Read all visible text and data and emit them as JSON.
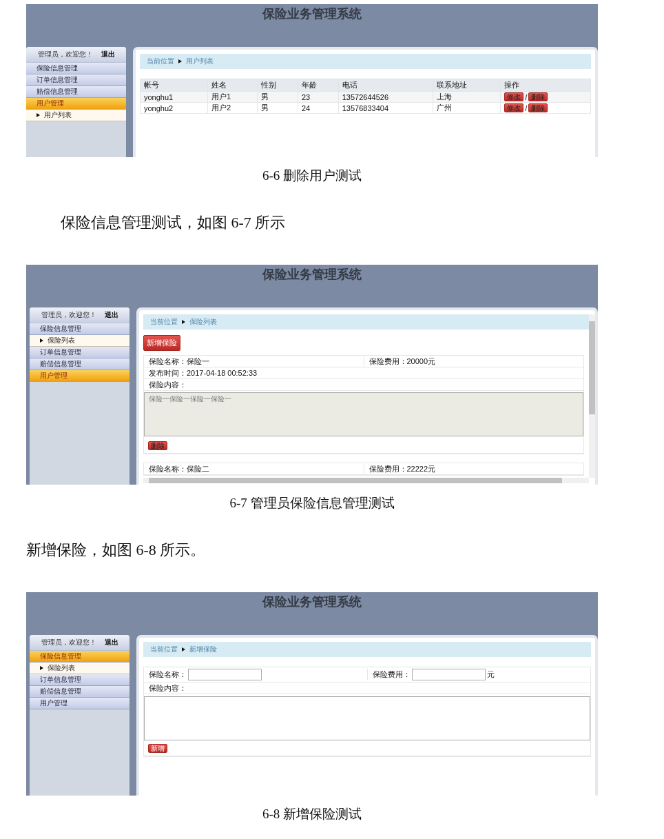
{
  "blocks": [
    {
      "kind": "figure",
      "screen": {
        "kind": "user-table",
        "title": "保险业务管理系统",
        "greeting": "管理员，欢迎您！",
        "logout": "退出",
        "nav": [
          {
            "label": "保险信息管理",
            "selected": false
          },
          {
            "label": "订单信息管理",
            "selected": false
          },
          {
            "label": "赔偿信息管理",
            "selected": false
          },
          {
            "label": "用户管理",
            "selected": true,
            "children": [
              {
                "label": "用户列表"
              }
            ]
          }
        ],
        "breadcrumb": {
          "home": "当前位置",
          "current": "用户列表"
        },
        "columns": [
          "帐号",
          "姓名",
          "性别",
          "年龄",
          "电话",
          "联系地址",
          "操作"
        ],
        "rows": [
          {
            "cells": [
              "yonghu1",
              "用户1",
              "男",
              "23",
              "13572644526",
              "上海"
            ],
            "edit": "修改",
            "separator": "/",
            "delete": "删除"
          },
          {
            "cells": [
              "yonghu2",
              "用户2",
              "男",
              "24",
              "13576833404",
              "广州"
            ],
            "edit": "修改",
            "separator": "/",
            "delete": "删除"
          }
        ]
      }
    },
    {
      "kind": "caption",
      "text": "6-6 删除用户测试"
    },
    {
      "kind": "paragraph",
      "indent": true,
      "text": "保险信息管理测试，如图 6-7 所示"
    },
    {
      "kind": "figure",
      "screen": {
        "kind": "insurance-list",
        "title": "保险业务管理系统",
        "greeting": "管理员，欢迎您！",
        "logout": "退出",
        "nav": [
          {
            "label": "保险信息管理",
            "selected": false,
            "children": [
              {
                "label": "保险列表"
              }
            ]
          },
          {
            "label": "订单信息管理",
            "selected": false
          },
          {
            "label": "赔偿信息管理",
            "selected": false
          },
          {
            "label": "用户管理",
            "selected": true
          }
        ],
        "breadcrumb": {
          "home": "当前位置",
          "current": "保险列表"
        },
        "add_button": "新增保险",
        "records": [
          {
            "name": "保险名称：保险一",
            "fee": "保险费用：20000元",
            "time": "发布时间：2017-04-18 00:52:33",
            "content_label": "保险内容：",
            "content": "保险一保险一保险一保险一",
            "delete": "删除"
          },
          {
            "name": "保险名称：保险二",
            "fee": "保险费用：22222元"
          }
        ]
      }
    },
    {
      "kind": "caption",
      "text": "6-7 管理员保险信息管理测试"
    },
    {
      "kind": "paragraph",
      "indent": false,
      "text": "新增保险，如图 6-8 所示。"
    },
    {
      "kind": "figure",
      "screen": {
        "kind": "insurance-form",
        "title": "保险业务管理系统",
        "greeting": "管理员，欢迎您！",
        "logout": "退出",
        "nav": [
          {
            "label": "保险信息管理",
            "selected": true,
            "children": [
              {
                "label": "保险列表"
              }
            ]
          },
          {
            "label": "订单信息管理",
            "selected": false
          },
          {
            "label": "赔偿信息管理",
            "selected": false
          },
          {
            "label": "用户管理",
            "selected": false
          }
        ],
        "breadcrumb": {
          "home": "当前位置",
          "current": "新增保险"
        },
        "name_label": "保险名称：",
        "fee_label": "保险费用：",
        "fee_unit": "元",
        "content_label": "保险内容：",
        "submit": "新增"
      }
    },
    {
      "kind": "caption",
      "text": "6-8 新增保险测试"
    }
  ]
}
